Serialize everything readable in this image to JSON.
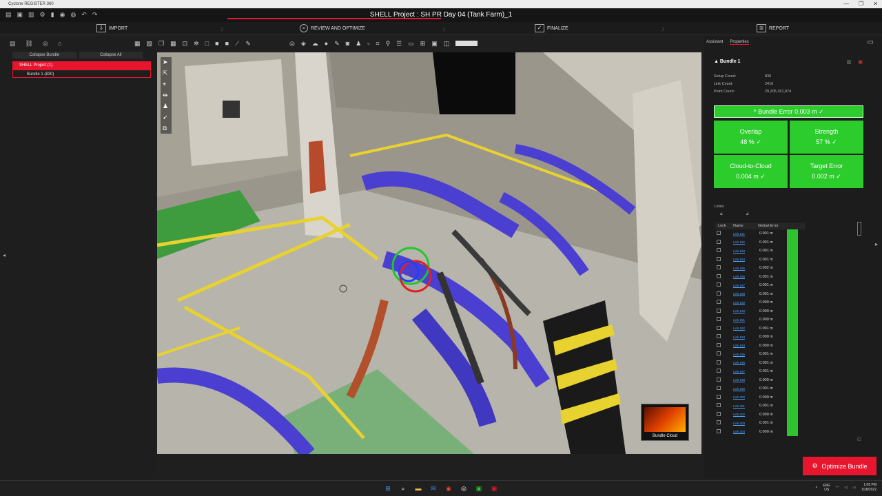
{
  "window": {
    "app_title": "Cyclone REGISTER 360",
    "controls": [
      "—",
      "❐",
      "✕"
    ]
  },
  "project_title": "SHELL Project : SH PR Day 04 (Tank Farm)_1",
  "steps": [
    {
      "label": "IMPORT",
      "icon": "import-icon"
    },
    {
      "label": "REVIEW AND OPTIMIZE",
      "icon": "search-icon"
    },
    {
      "label": "FINALIZE",
      "icon": "check-icon"
    },
    {
      "label": "REPORT",
      "icon": "report-icon"
    }
  ],
  "left_panel": {
    "collapse_bundle": "Collapse Bundle",
    "collapse_all": "Collapse All",
    "tree": [
      {
        "label": "SHELL Project (1)",
        "selected": true
      },
      {
        "label": "Bundle 1 (830)",
        "selected": false
      }
    ]
  },
  "right_panel": {
    "tabs": [
      "Assistant",
      "Properties"
    ],
    "header": "Bundle 1",
    "stats": [
      {
        "key": "Setup Count:",
        "value": "830"
      },
      {
        "key": "Link Count:",
        "value": "2416"
      },
      {
        "key": "Point Count:",
        "value": "29,205,161,074"
      }
    ],
    "bundle_error": "^ Bundle Error 0.003 m  ✓",
    "quality": [
      {
        "label": "Overlap",
        "value": "48 %  ✓"
      },
      {
        "label": "Strength",
        "value": "57 %  ✓"
      },
      {
        "label": "Cloud-to-Cloud",
        "value": "0.004 m  ✓"
      },
      {
        "label": "Target Error",
        "value": "0.002 m  ✓"
      }
    ],
    "links_label": "Links:",
    "table_headers": [
      "Lock",
      "Name",
      "Global Error"
    ],
    "links": [
      {
        "name": "Link 181",
        "error": "0.001 m"
      },
      {
        "name": "Link 182",
        "error": "0.001 m"
      },
      {
        "name": "Link 183",
        "error": "0.001 m"
      },
      {
        "name": "Link 184",
        "error": "0.001 m"
      },
      {
        "name": "Link 185",
        "error": "0.002 m"
      },
      {
        "name": "Link 186",
        "error": "0.001 m"
      },
      {
        "name": "Link 187",
        "error": "0.001 m"
      },
      {
        "name": "Link 188",
        "error": "0.001 m"
      },
      {
        "name": "Link 189",
        "error": "0.000 m"
      },
      {
        "name": "Link 190",
        "error": "0.000 m"
      },
      {
        "name": "Link 191",
        "error": "0.000 m"
      },
      {
        "name": "Link 192",
        "error": "0.001 m"
      },
      {
        "name": "Link 193",
        "error": "0.000 m"
      },
      {
        "name": "Link 194",
        "error": "0.000 m"
      },
      {
        "name": "Link 195",
        "error": "0.001 m"
      },
      {
        "name": "Link 196",
        "error": "0.001 m"
      },
      {
        "name": "Link 197",
        "error": "0.001 m"
      },
      {
        "name": "Link 198",
        "error": "0.000 m"
      },
      {
        "name": "Link 199",
        "error": "0.001 m"
      },
      {
        "name": "Link 200",
        "error": "0.000 m"
      },
      {
        "name": "Link 201",
        "error": "0.001 m"
      },
      {
        "name": "Link 202",
        "error": "0.000 m"
      },
      {
        "name": "Link 203",
        "error": "0.001 m"
      },
      {
        "name": "Link 204",
        "error": "0.000 m"
      }
    ],
    "optimize_button": "Optimize Bundle"
  },
  "viewport": {
    "thumbnail_label": "Bundle Cloud"
  },
  "taskbar": {
    "lang_top": "ENG",
    "lang_bottom": "US",
    "time": "1:06 PM",
    "date": "11/8/2022"
  },
  "colors": {
    "accent": "#e8152f",
    "quality_green": "#2bcc2b"
  }
}
